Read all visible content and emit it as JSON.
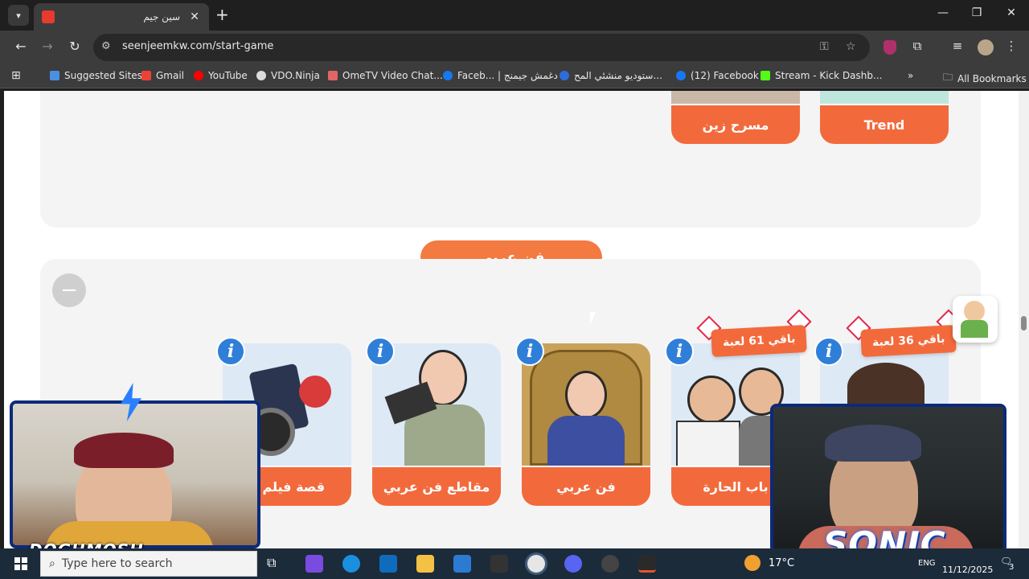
{
  "browser": {
    "tab_title": "سين جيم",
    "url": "seenjeemkw.com/start-game",
    "bookmarks": [
      {
        "label": "Suggested Sites",
        "color": "#4a90e2"
      },
      {
        "label": "Gmail",
        "color": "#ea4335"
      },
      {
        "label": "YouTube",
        "color": "#ff0000"
      },
      {
        "label": "VDO.Ninja",
        "color": "#dddddd"
      },
      {
        "label": "OmeTV Video Chat...",
        "color": "#e06666"
      },
      {
        "label": "Faceb... | دغمش جيمنج",
        "color": "#1877f2"
      },
      {
        "label": "ستوديو منشئي المح...",
        "color": "#2d6cdf"
      },
      {
        "label": "(12) Facebook",
        "color": "#1877f2"
      },
      {
        "label": "Stream - Kick Dashb...",
        "color": "#53fc18"
      }
    ],
    "all_bookmarks": "All Bookmarks"
  },
  "page": {
    "top_cards": [
      {
        "label": "مسرح زين"
      },
      {
        "label": "Trend"
      }
    ],
    "section_title": "فن عربي",
    "collapse_symbol": "−",
    "cards": [
      {
        "label": "قصة فيلم ع",
        "remaining": ""
      },
      {
        "label": "مقاطع فن عربي",
        "remaining": ""
      },
      {
        "label": "فن عربي",
        "remaining": ""
      },
      {
        "label": "باب الحارة",
        "remaining": "باقي 61 لعبة"
      },
      {
        "label": "",
        "remaining": "باقي 36 لعبة"
      }
    ],
    "info_symbol": "i"
  },
  "overlay": {
    "streamer_name": "DOGHMOSH",
    "sonic_logo": "SONIC"
  },
  "taskbar": {
    "search_placeholder": "Type here to search",
    "weather": "17°C",
    "language": "ENG",
    "date": "11/12/2025",
    "notifications": "3"
  },
  "colors": {
    "accent_orange": "#f26a3c",
    "info_blue": "#2f7fd8",
    "panel_grey": "#f4f4f4"
  }
}
